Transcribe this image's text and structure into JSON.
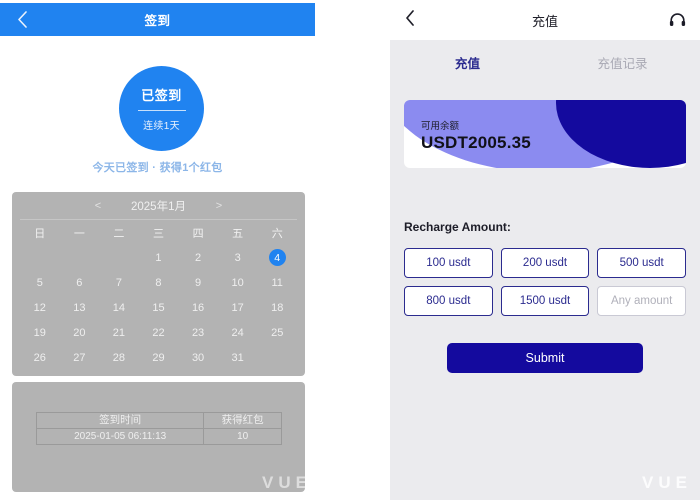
{
  "checkin": {
    "header": {
      "title": "签到",
      "back_icon": "chevron-left-icon"
    },
    "circle": {
      "status": "已签到",
      "streak": "连续1天"
    },
    "note": "今天已签到 · 获得1个红包",
    "calendar": {
      "prev_label": "<",
      "next_label": ">",
      "month_label": "2025年1月",
      "weekdays": [
        "日",
        "一",
        "二",
        "三",
        "四",
        "五",
        "六"
      ],
      "leading_blanks": 3,
      "days": [
        1,
        2,
        3,
        4,
        5,
        6,
        7,
        8,
        9,
        10,
        11,
        12,
        13,
        14,
        15,
        16,
        17,
        18,
        19,
        20,
        21,
        22,
        23,
        24,
        25,
        26,
        27,
        28,
        29,
        30,
        31
      ],
      "selected_day": 4,
      "selected_color": "#2083f0"
    },
    "record": {
      "columns": [
        "签到时间",
        "获得红包"
      ],
      "rows": [
        [
          "2025-01-05 06:11:13",
          "10"
        ]
      ]
    },
    "watermark": "VUE"
  },
  "recharge": {
    "header": {
      "title": "充值",
      "back_icon": "chevron-left-icon",
      "support_icon": "headset-icon"
    },
    "tabs": [
      {
        "label": "充值",
        "active": true
      },
      {
        "label": "充值记录",
        "active": false
      }
    ],
    "balance": {
      "label": "可用余额",
      "value": "USDT2005.35"
    },
    "amount_section_label": "Recharge Amount:",
    "amount_options": [
      {
        "label": "100 usdt",
        "type": "preset"
      },
      {
        "label": "200 usdt",
        "type": "preset"
      },
      {
        "label": "500 usdt",
        "type": "preset"
      },
      {
        "label": "800 usdt",
        "type": "preset"
      },
      {
        "label": "1500 usdt",
        "type": "preset"
      },
      {
        "label": "Any amount",
        "type": "placeholder"
      }
    ],
    "submit_label": "Submit",
    "watermark": "VUE",
    "colors": {
      "accent": "#2b2b8f",
      "submit": "#140a9e",
      "card_light": "#8b8bf0",
      "panel_bg": "#ebebee"
    }
  }
}
